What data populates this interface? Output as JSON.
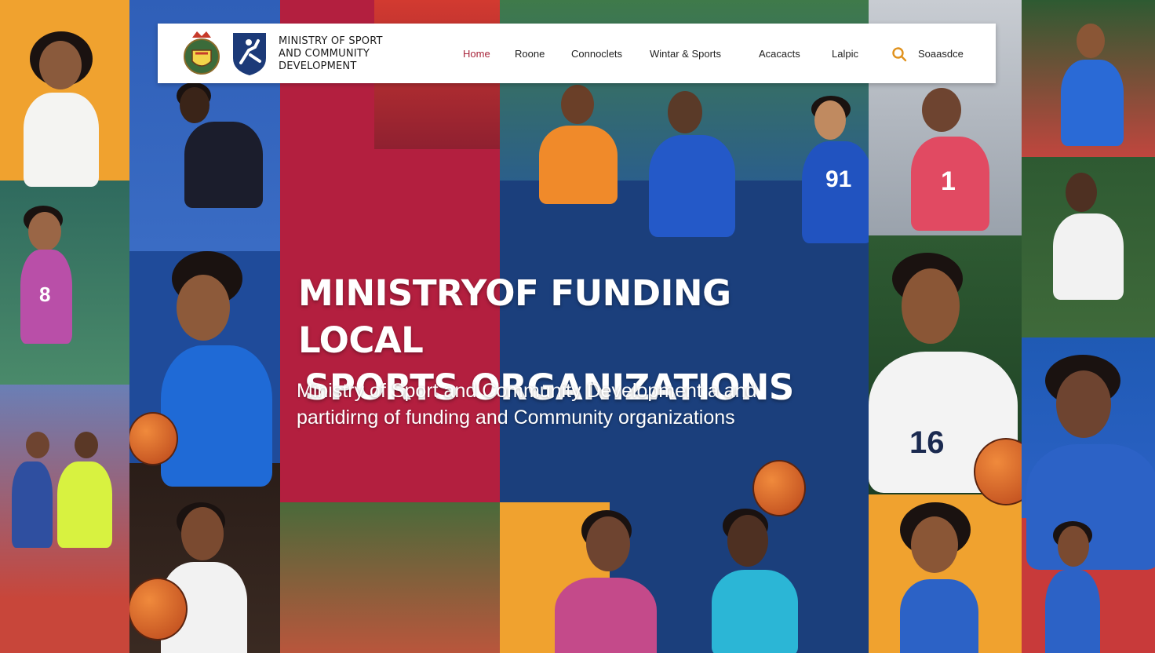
{
  "header": {
    "brand_lines": [
      "MINISTRY OF SPORT",
      "AND COMMUNITY",
      "DEVELOPMENT"
    ],
    "nav": [
      {
        "label": "Home",
        "active": true
      },
      {
        "label": "Roone",
        "active": false
      },
      {
        "label": "Connoclets",
        "active": false
      },
      {
        "label": "Wintar & Sports",
        "active": false
      },
      {
        "label": "Acacacts",
        "active": false
      },
      {
        "label": "Lalpic",
        "active": false
      }
    ],
    "search_label": "Soaasdce",
    "search_icon": "search-icon"
  },
  "hero": {
    "title_line1": "MINISTRYOF FUNDING LOCAL",
    "title_line2": "SPORTS ORGANIZATIONS",
    "subtitle_line1": "Ministry of Sport and Community Development a and",
    "subtitle_line2": "partidirng of funding and Community organizations"
  },
  "jersey_numbers": {
    "left_athlete": "8",
    "top_runner": "91",
    "top_right_athlete": "1",
    "right_player": "16"
  },
  "colors": {
    "accent_red": "#b31f3f",
    "accent_navy": "#1b3f7c",
    "accent_orange": "#f0a22f",
    "active_nav": "#a8243a",
    "search_icon": "#e0921e"
  }
}
